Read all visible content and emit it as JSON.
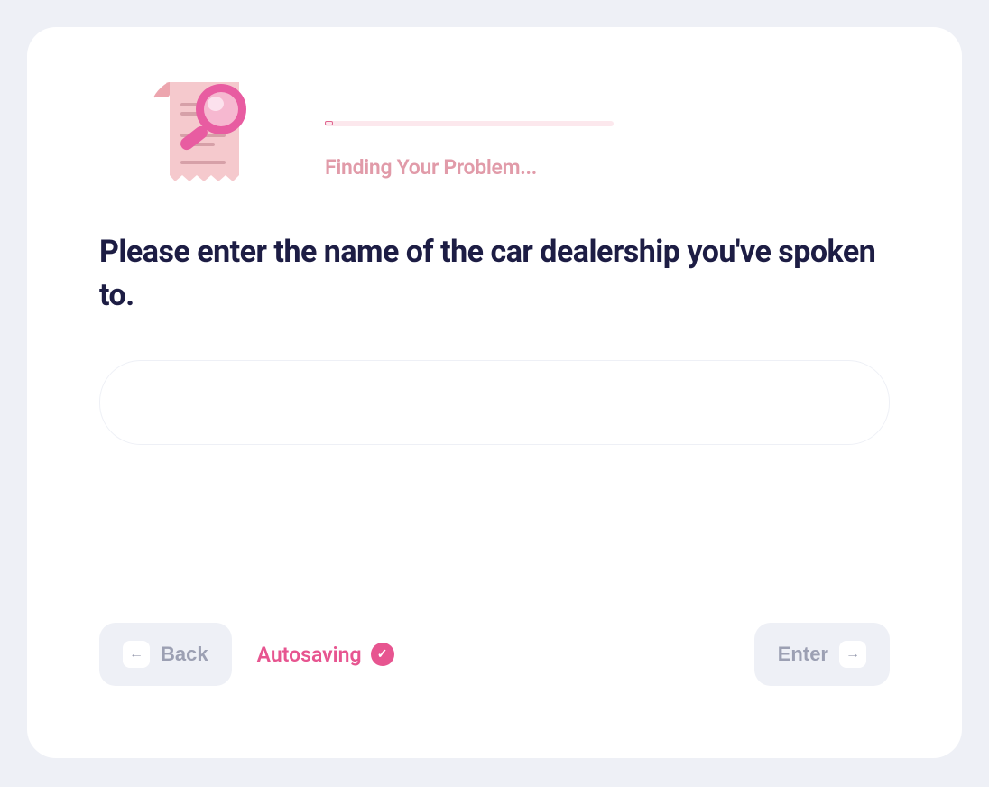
{
  "progress": {
    "label": "Finding Your Problem..."
  },
  "question": {
    "title": "Please enter the name of the car dealership you've spoken to."
  },
  "input": {
    "value": "",
    "placeholder": ""
  },
  "footer": {
    "back_label": "Back",
    "autosaving_label": "Autosaving",
    "enter_label": "Enter"
  },
  "icons": {
    "document_search": "document-search-icon",
    "arrow_left": "←",
    "arrow_right": "→",
    "check": "✓"
  }
}
